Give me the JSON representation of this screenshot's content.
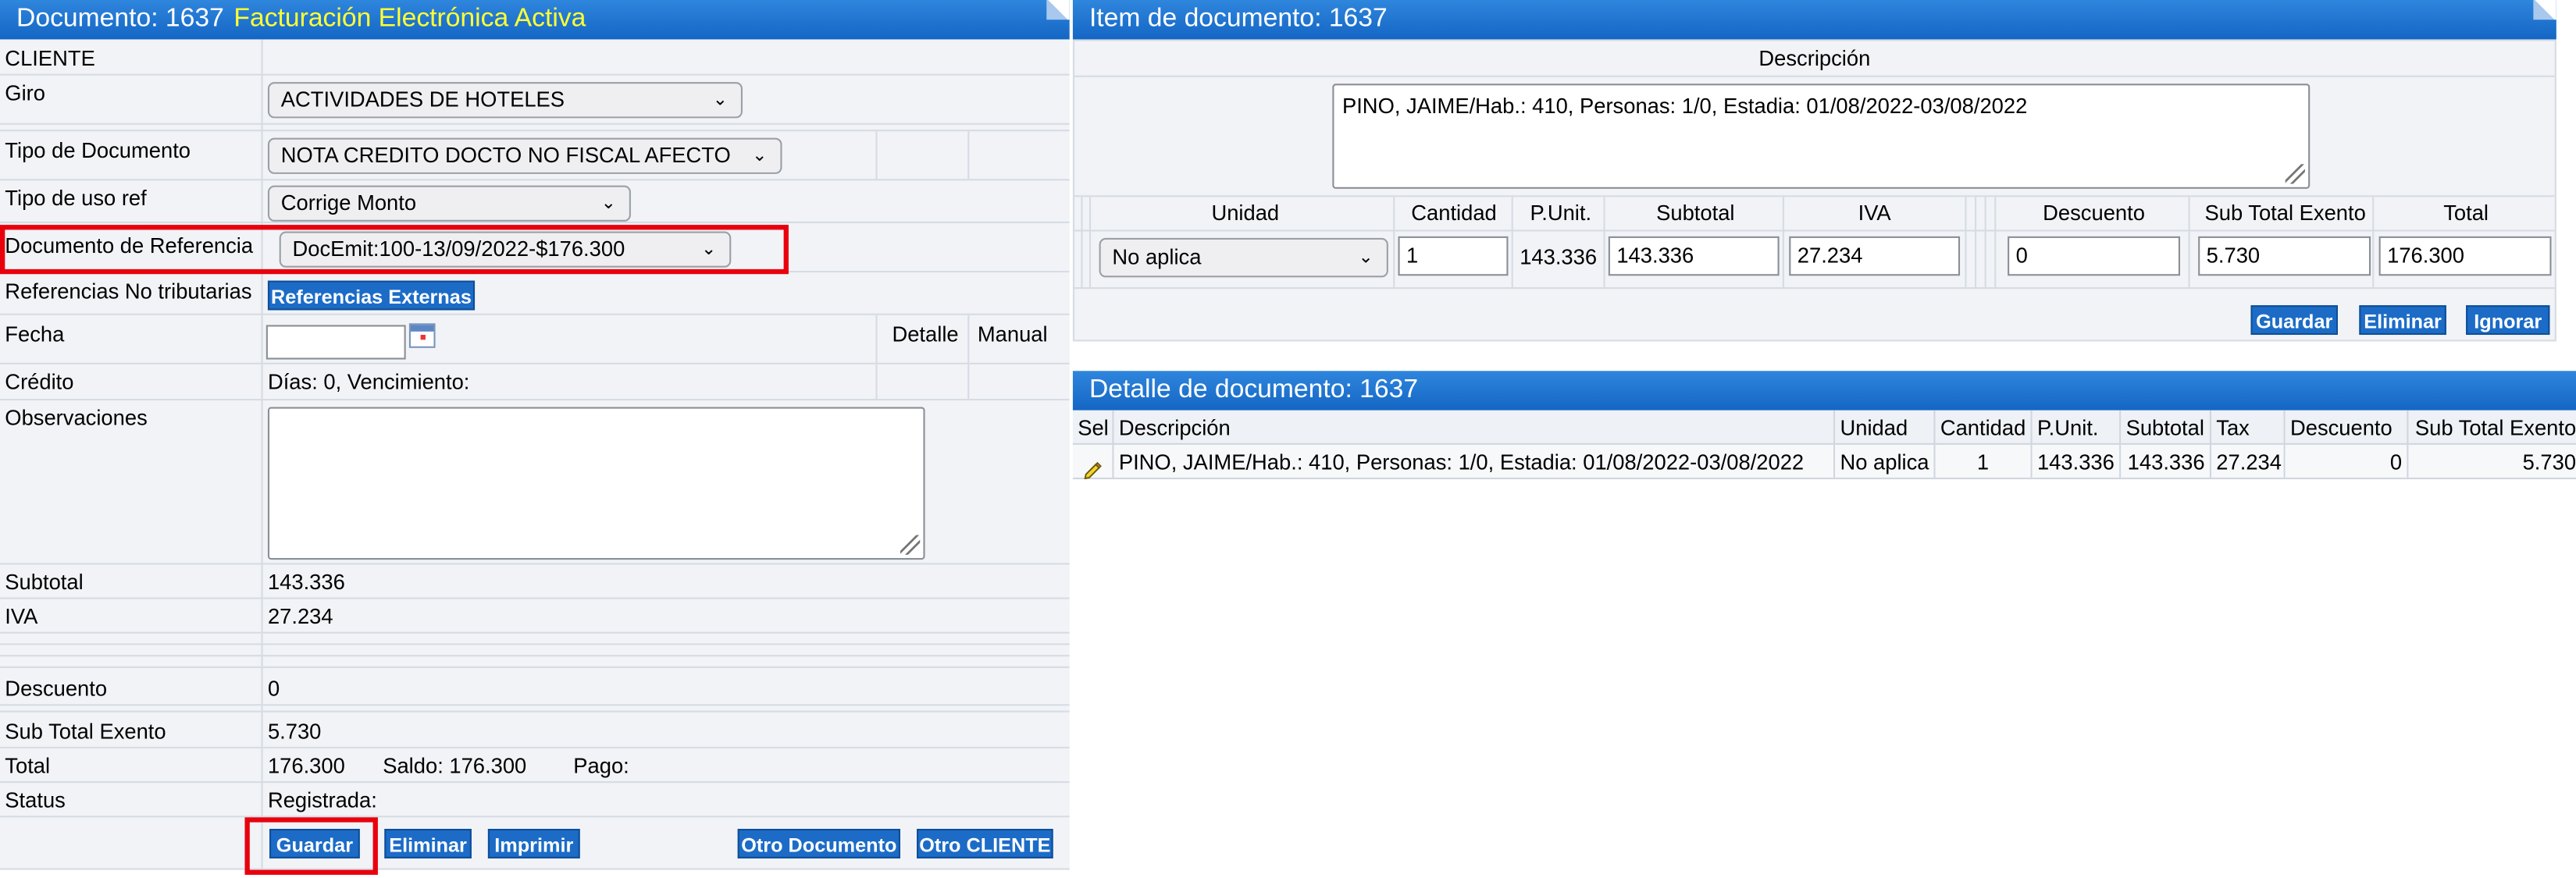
{
  "left_header": {
    "title": "Documento: 1637",
    "badge": "Facturación Electrónica Activa"
  },
  "form": {
    "cliente_label": "CLIENTE",
    "giro_label": "Giro",
    "giro_value": "ACTIVIDADES DE HOTELES",
    "tipo_doc_label": "Tipo de Documento",
    "tipo_doc_value": "NOTA CREDITO DOCTO NO FISCAL AFECTO",
    "tipo_uso_label": "Tipo de uso ref",
    "tipo_uso_value": "Corrige Monto",
    "doc_ref_label": "Documento de Referencia",
    "doc_ref_value": "DocEmit:100-13/09/2022-$176.300",
    "refs_label": "Referencias No tributarias",
    "refs_button": "Referencias Externas",
    "fecha_label": "Fecha",
    "fecha_value": "",
    "detalle_label": "Detalle",
    "manual_label": "Manual",
    "credito_label": "Crédito",
    "credito_value": "Días: 0, Vencimiento:",
    "obs_label": "Observaciones",
    "subtotal_label": "Subtotal",
    "subtotal_value": "143.336",
    "iva_label": "IVA",
    "iva_value": "27.234",
    "descuento_label": "Descuento",
    "descuento_value": "0",
    "exento_label": "Sub Total Exento",
    "exento_value": "5.730",
    "total_label": "Total",
    "total_value": "176.300",
    "saldo_text": "Saldo: 176.300",
    "pago_text": "Pago:",
    "status_label": "Status",
    "status_value": "Registrada:"
  },
  "left_buttons": {
    "guardar": "Guardar",
    "eliminar": "Eliminar",
    "imprimir": "Imprimir",
    "otro_documento": "Otro Documento",
    "otro_cliente": "Otro CLIENTE"
  },
  "item_header": {
    "title": "Item de documento: 1637"
  },
  "item": {
    "descripcion_label": "Descripción",
    "descripcion_value": "PINO, JAIME/Hab.: 410, Personas: 1/0, Estadia: 01/08/2022-03/08/2022",
    "col_unidad": "Unidad",
    "col_cantidad": "Cantidad",
    "col_punit": "P.Unit.",
    "col_subtotal": "Subtotal",
    "col_iva": "IVA",
    "col_descuento": "Descuento",
    "col_exento": "Sub Total Exento",
    "col_total": "Total",
    "unidad_value": "No aplica",
    "cantidad_value": "1",
    "punit_value": "143.336",
    "subtotal_value": "143.336",
    "iva_value": "27.234",
    "descuento_value": "0",
    "exento_value": "5.730",
    "total_value": "176.300",
    "btn_guardar": "Guardar",
    "btn_eliminar": "Eliminar",
    "btn_ignorar": "Ignorar"
  },
  "detail_header": {
    "title": "Detalle de documento: 1637"
  },
  "detail": {
    "headers": [
      "Sel",
      "Descripción",
      "Unidad",
      "Cantidad",
      "P.Unit.",
      "Subtotal",
      "Tax",
      "Descuento",
      "Sub Total Exento"
    ],
    "row": {
      "descripcion": "PINO, JAIME/Hab.: 410, Personas: 1/0, Estadia: 01/08/2022-03/08/2022",
      "unidad": "No aplica",
      "cantidad": "1",
      "punit": "143.336",
      "subtotal": "143.336",
      "tax": "27.234",
      "descuento": "0",
      "exento": "5.730"
    }
  },
  "colors": {
    "header_blue": "#1466c4",
    "button_blue": "#1c6cc7",
    "highlight_red": "#e8000d",
    "badge_yellow": "#ffff33"
  },
  "icons": [
    "calendar-icon",
    "chevron-down-icon",
    "pencil-icon",
    "resize-grip-icon"
  ]
}
